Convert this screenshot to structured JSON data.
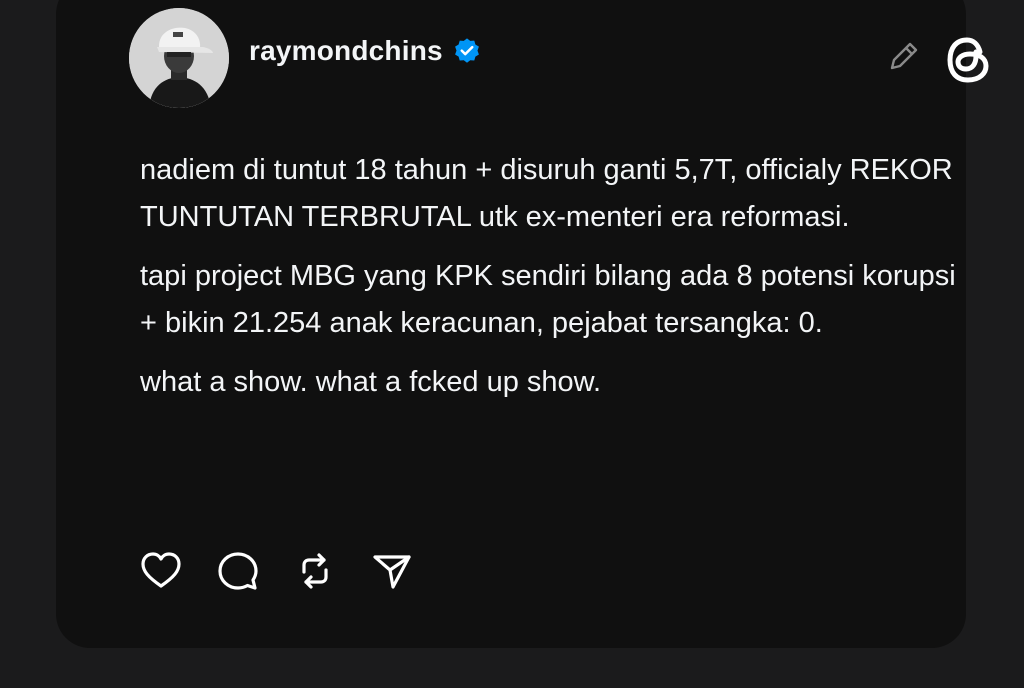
{
  "post": {
    "username": "raymondchins",
    "verified": true,
    "paragraphs": [
      "nadiem di tuntut 18 tahun + disuruh ganti 5,7T, officialy REKOR TUNTUTAN TERBRUTAL utk ex-menteri era reformasi.",
      "tapi project MBG yang KPK sendiri bilang ada 8 potensi korupsi + bikin 21.254 anak keracunan, pejabat tersangka: 0.",
      "what a show. what a fcked up show."
    ]
  },
  "icons": {
    "verified": "verified-badge-icon",
    "edit": "pencil-icon",
    "app_logo": "threads-logo-icon",
    "like": "heart-icon",
    "reply": "comment-icon",
    "repost": "repost-icon",
    "share": "send-icon"
  },
  "colors": {
    "background": "#1b1b1c",
    "card": "#101010",
    "text": "#f3f5f7",
    "verified_blue": "#0095f6",
    "muted_icon": "#8a8a8a"
  }
}
